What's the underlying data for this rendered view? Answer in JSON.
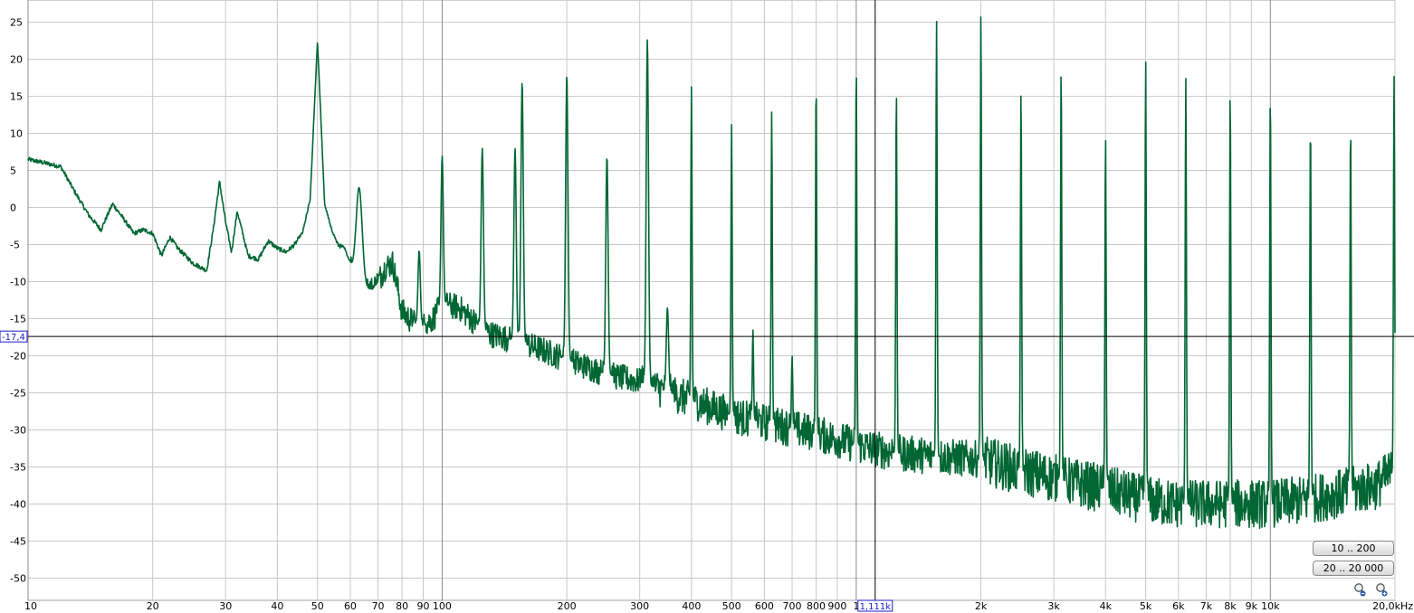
{
  "chart_data": {
    "type": "line",
    "title": "",
    "xlabel": "",
    "ylabel": "",
    "x_scale": "log",
    "xlim": [
      10,
      20000
    ],
    "ylim": [
      -53,
      28
    ],
    "grid": true,
    "y_ticks": [
      25,
      20,
      15,
      10,
      5,
      0,
      -5,
      -10,
      -15,
      -20,
      -25,
      -30,
      -35,
      -40,
      -45,
      -50
    ],
    "x_ticks": [
      {
        "value": 10,
        "label": "10"
      },
      {
        "value": 20,
        "label": "20"
      },
      {
        "value": 30,
        "label": "30"
      },
      {
        "value": 40,
        "label": "40"
      },
      {
        "value": 50,
        "label": "50"
      },
      {
        "value": 60,
        "label": "60"
      },
      {
        "value": 70,
        "label": "70"
      },
      {
        "value": 80,
        "label": "80"
      },
      {
        "value": 90,
        "label": "90"
      },
      {
        "value": 100,
        "label": "100"
      },
      {
        "value": 200,
        "label": "200"
      },
      {
        "value": 300,
        "label": "300"
      },
      {
        "value": 400,
        "label": "400"
      },
      {
        "value": 500,
        "label": "500"
      },
      {
        "value": 600,
        "label": "600"
      },
      {
        "value": 700,
        "label": "700"
      },
      {
        "value": 800,
        "label": "800"
      },
      {
        "value": 900,
        "label": "900"
      },
      {
        "value": 1000,
        "label": "1"
      },
      {
        "value": 2000,
        "label": "2k"
      },
      {
        "value": 3000,
        "label": "3k"
      },
      {
        "value": 4000,
        "label": "4k"
      },
      {
        "value": 5000,
        "label": "5k"
      },
      {
        "value": 6000,
        "label": "6k"
      },
      {
        "value": 7000,
        "label": "7k"
      },
      {
        "value": 8000,
        "label": "8k"
      },
      {
        "value": 9000,
        "label": "9k"
      },
      {
        "value": 10000,
        "label": "10k"
      },
      {
        "value": 20000,
        "label": "20,0kHz"
      }
    ],
    "series": [
      {
        "color": "#006633",
        "base_points": [
          [
            10,
            6.5
          ],
          [
            11,
            6.0
          ],
          [
            12,
            5.5
          ],
          [
            13,
            2.0
          ],
          [
            14,
            -1.0
          ],
          [
            15,
            -3.0
          ],
          [
            16,
            0.5
          ],
          [
            17,
            -1.5
          ],
          [
            18,
            -3.5
          ],
          [
            19,
            -3.0
          ],
          [
            20,
            -3.5
          ],
          [
            21,
            -6.5
          ],
          [
            22,
            -4.0
          ],
          [
            23,
            -5.5
          ],
          [
            25,
            -7.5
          ],
          [
            27,
            -8.5
          ],
          [
            28,
            -3.0
          ],
          [
            29,
            3.5
          ],
          [
            30,
            -2.0
          ],
          [
            31,
            -6.0
          ],
          [
            32,
            -0.5
          ],
          [
            34,
            -6.5
          ],
          [
            36,
            -7.0
          ],
          [
            38,
            -4.5
          ],
          [
            40,
            -5.5
          ],
          [
            42,
            -6.0
          ],
          [
            44,
            -5.0
          ],
          [
            46,
            -3.5
          ],
          [
            48,
            1.0
          ],
          [
            50,
            22.5
          ],
          [
            52,
            0.5
          ],
          [
            54,
            -3.0
          ],
          [
            56,
            -5.0
          ],
          [
            58,
            -5.5
          ],
          [
            60,
            -7.5
          ],
          [
            62,
            -10.5
          ],
          [
            65,
            -11.0
          ],
          [
            68,
            -11.0
          ],
          [
            70,
            -10.0
          ],
          [
            73,
            -8.0
          ],
          [
            76,
            -7.5
          ],
          [
            80,
            -14.0
          ],
          [
            85,
            -15.5
          ],
          [
            90,
            -16.0
          ],
          [
            95,
            -15.0
          ],
          [
            100,
            -13.0
          ],
          [
            110,
            -13.5
          ],
          [
            120,
            -15.5
          ],
          [
            130,
            -17.0
          ],
          [
            140,
            -17.5
          ],
          [
            160,
            -18.5
          ],
          [
            180,
            -19.5
          ],
          [
            200,
            -20.5
          ],
          [
            250,
            -22.5
          ],
          [
            300,
            -23.5
          ],
          [
            400,
            -26.0
          ],
          [
            500,
            -28.0
          ],
          [
            600,
            -29.0
          ],
          [
            800,
            -30.5
          ],
          [
            1000,
            -32.0
          ],
          [
            1200,
            -33.0
          ],
          [
            1500,
            -33.5
          ],
          [
            2000,
            -34.0
          ],
          [
            2500,
            -35.5
          ],
          [
            3000,
            -36.5
          ],
          [
            4000,
            -38.0
          ],
          [
            5000,
            -39.5
          ],
          [
            6000,
            -40.0
          ],
          [
            8000,
            -40.0
          ],
          [
            10000,
            -40.0
          ],
          [
            12000,
            -39.5
          ],
          [
            15000,
            -38.5
          ],
          [
            18000,
            -37.5
          ],
          [
            20000,
            -35.5
          ]
        ],
        "peaks": [
          {
            "x": 50,
            "y": 22.5
          },
          {
            "x": 63,
            "y": 2.7
          },
          {
            "x": 88,
            "y": -5.8
          },
          {
            "x": 100,
            "y": 7.0
          },
          {
            "x": 125,
            "y": 8.0
          },
          {
            "x": 150,
            "y": 8.0
          },
          {
            "x": 156,
            "y": 17.0
          },
          {
            "x": 200,
            "y": 18.0
          },
          {
            "x": 250,
            "y": 7.0
          },
          {
            "x": 313,
            "y": 22.7
          },
          {
            "x": 350,
            "y": -13.5
          },
          {
            "x": 400,
            "y": 16.3
          },
          {
            "x": 500,
            "y": 11.2
          },
          {
            "x": 563,
            "y": -16.5
          },
          {
            "x": 625,
            "y": 13.0
          },
          {
            "x": 700,
            "y": -20.0
          },
          {
            "x": 800,
            "y": 17.3
          },
          {
            "x": 1000,
            "y": 19.5
          },
          {
            "x": 1250,
            "y": 16.0
          },
          {
            "x": 1563,
            "y": 25.3
          },
          {
            "x": 2000,
            "y": 26.3
          },
          {
            "x": 2500,
            "y": 16.0
          },
          {
            "x": 3125,
            "y": 19.3
          },
          {
            "x": 4000,
            "y": 9.7
          },
          {
            "x": 5000,
            "y": 20.0
          },
          {
            "x": 6250,
            "y": 17.5
          },
          {
            "x": 8000,
            "y": 16.2
          },
          {
            "x": 10000,
            "y": 16.0
          },
          {
            "x": 12500,
            "y": 12.0
          },
          {
            "x": 15625,
            "y": 11.5
          },
          {
            "x": 19900,
            "y": 17.7
          }
        ]
      }
    ],
    "cursor": {
      "x_label": "1,111k",
      "y_label": "-17,4",
      "x": 1111,
      "y": -17.4
    }
  },
  "controls": {
    "range_a": "10 .. 200",
    "range_b": "20 .. 20 000",
    "zoom_out_icon": "zoom-out-icon",
    "zoom_in_icon": "zoom-in-icon"
  }
}
